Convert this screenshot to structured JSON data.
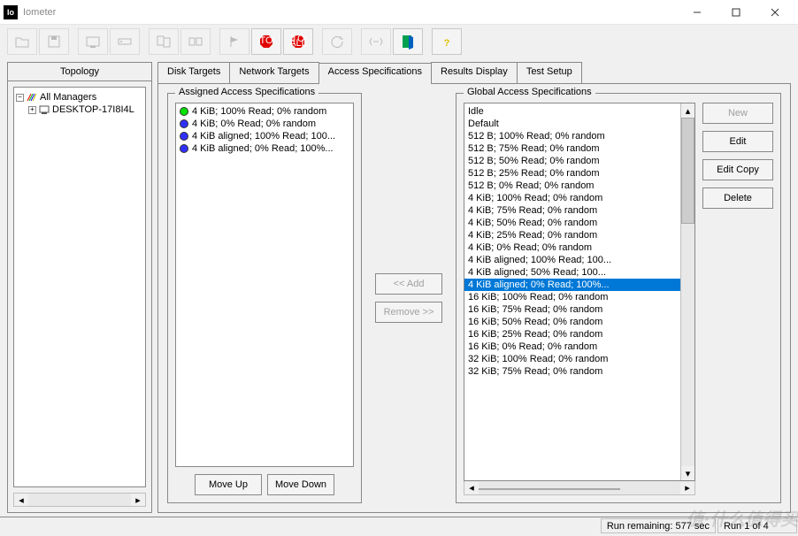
{
  "window": {
    "title": "Iometer"
  },
  "toolbar": {
    "icons": [
      "open",
      "save",
      "disk-mgr",
      "net-mgr",
      "copy-top",
      "copy-all",
      "flag",
      "stop",
      "stop-all",
      "undo",
      "reset",
      "exit",
      "help"
    ]
  },
  "topology": {
    "label": "Topology",
    "root": "All Managers",
    "child": "DESKTOP-17I8I4L"
  },
  "tabs": {
    "items": [
      "Disk Targets",
      "Network Targets",
      "Access Specifications",
      "Results Display",
      "Test Setup"
    ],
    "active": 2
  },
  "assigned": {
    "legend": "Assigned Access Specifications",
    "items": [
      {
        "color": "green",
        "label": "4 KiB; 100% Read; 0% random"
      },
      {
        "color": "blue",
        "label": "4 KiB; 0% Read; 0% random"
      },
      {
        "color": "blue",
        "label": "4 KiB aligned; 100% Read; 100..."
      },
      {
        "color": "blue",
        "label": "4 KiB aligned; 0% Read; 100%..."
      }
    ],
    "move_up": "Move Up",
    "move_down": "Move Down"
  },
  "mid": {
    "add": "<< Add",
    "remove": "Remove >>"
  },
  "global": {
    "legend": "Global Access Specifications",
    "items": [
      "Idle",
      "Default",
      "512 B; 100% Read; 0% random",
      "512 B; 75% Read; 0% random",
      "512 B; 50% Read; 0% random",
      "512 B; 25% Read; 0% random",
      "512 B; 0% Read; 0% random",
      "4 KiB; 100% Read; 0% random",
      "4 KiB; 75% Read; 0% random",
      "4 KiB; 50% Read; 0% random",
      "4 KiB; 25% Read; 0% random",
      "4 KiB; 0% Read; 0% random",
      "4 KiB aligned; 100% Read; 100...",
      "4 KiB aligned; 50% Read; 100...",
      "4 KiB aligned; 0% Read; 100%...",
      "16 KiB; 100% Read; 0% random",
      "16 KiB; 75% Read; 0% random",
      "16 KiB; 50% Read; 0% random",
      "16 KiB; 25% Read; 0% random",
      "16 KiB; 0% Read; 0% random",
      "32 KiB; 100% Read; 0% random",
      "32 KiB; 75% Read; 0% random"
    ],
    "selected_index": 14,
    "buttons": {
      "new": "New",
      "edit": "Edit",
      "edit_copy": "Edit Copy",
      "delete": "Delete"
    }
  },
  "status": {
    "remaining": "Run remaining: 577 sec",
    "run": "Run 1 of 4"
  },
  "watermark": "值·什么值得买"
}
